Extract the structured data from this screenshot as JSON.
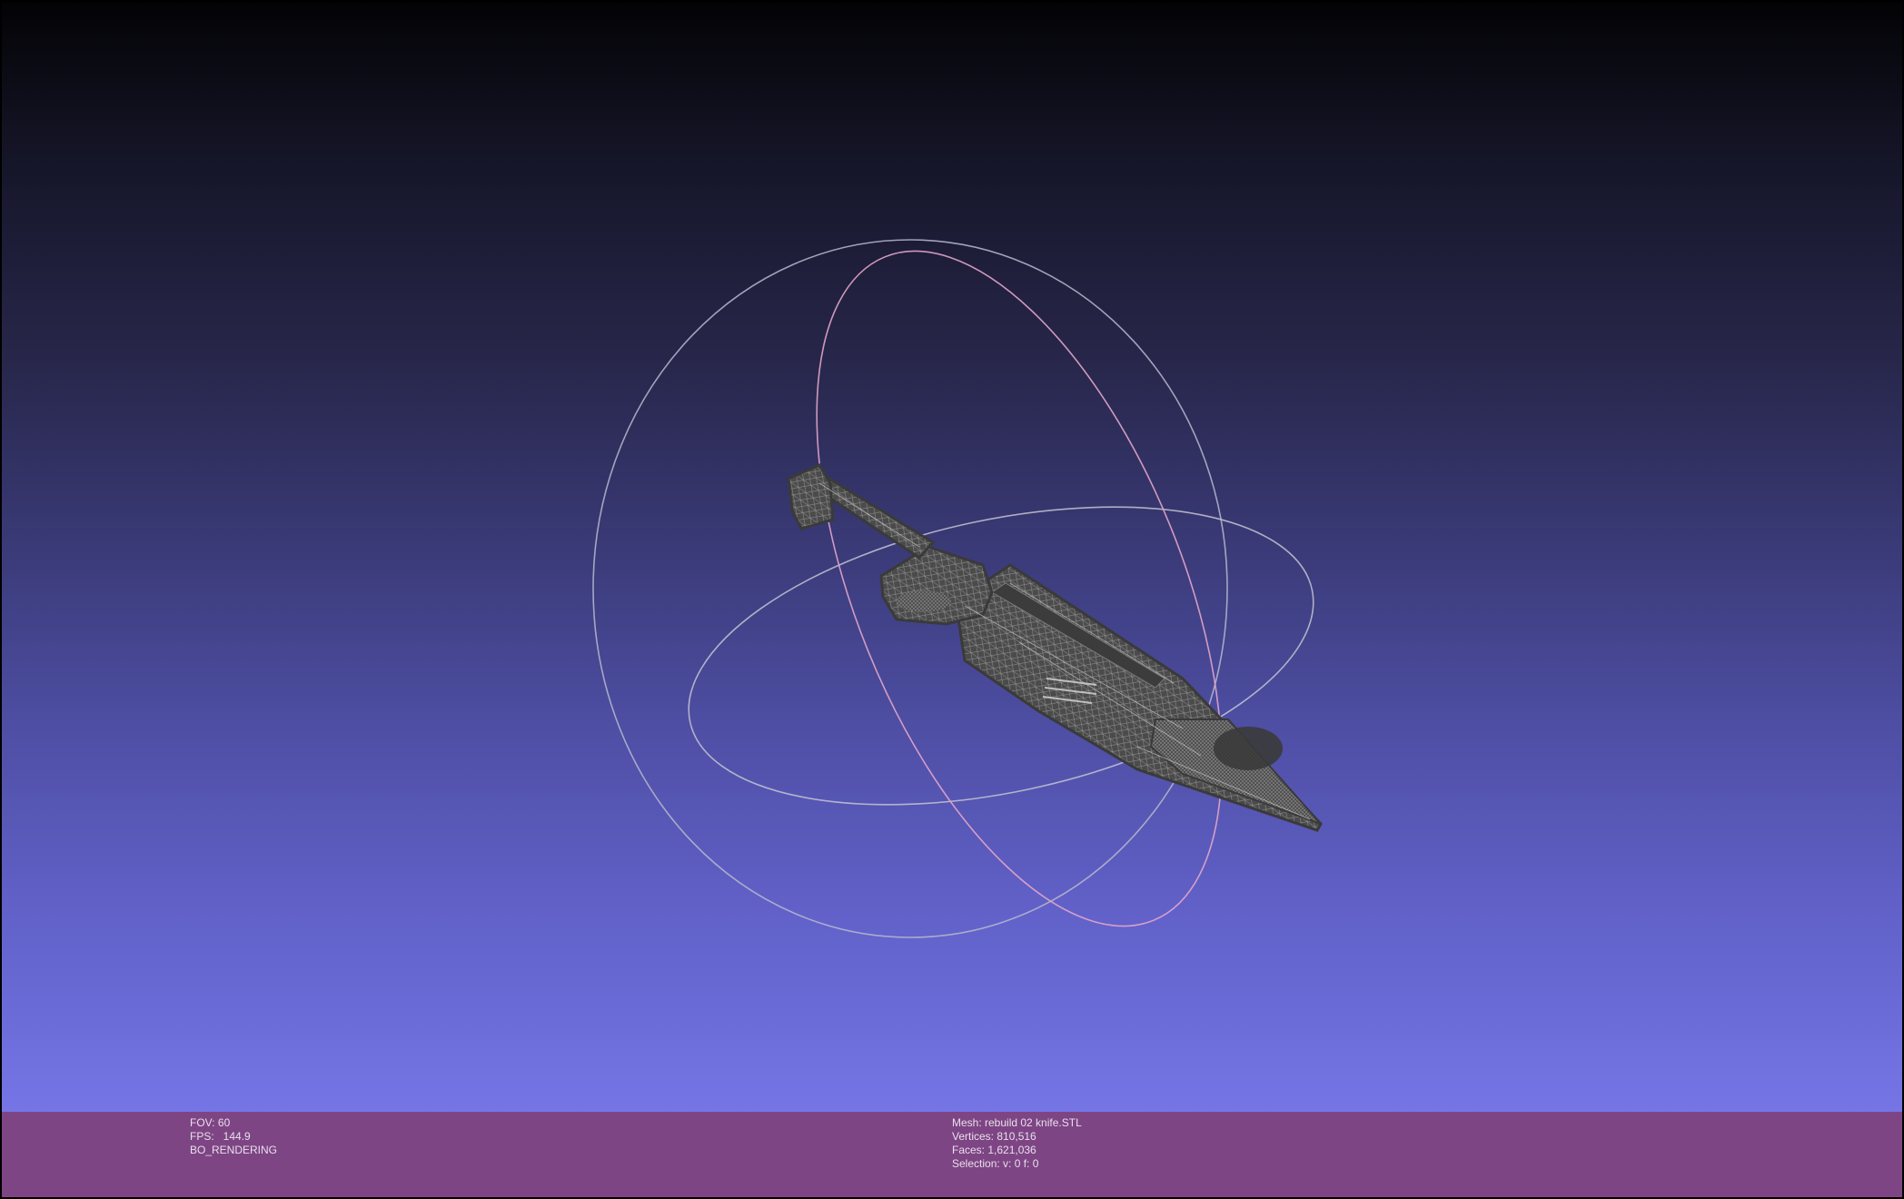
{
  "viewer": {
    "info_left": {
      "fov": "FOV: 60",
      "fps": "FPS:   144.9",
      "mode": "BO_RENDERING"
    },
    "info_right": {
      "mesh": "Mesh: rebuild 02 knife.STL",
      "vertices": "Vertices: 810,516",
      "faces": "Faces: 1,621,036",
      "selection": "Selection: v: 0 f: 0"
    }
  },
  "colors": {
    "background_top": "#030305",
    "background_bottom": "#7575e6",
    "info_bar": "#7e4585",
    "mesh": "#4a4a4a",
    "wireframe": "#bdbdbd",
    "trackball": "#c9c9d6",
    "trackball_vertical": "#e2a6c9"
  },
  "icons": {
    "trackball": "trackball-rings-icon",
    "model": "knife-mesh-icon"
  }
}
